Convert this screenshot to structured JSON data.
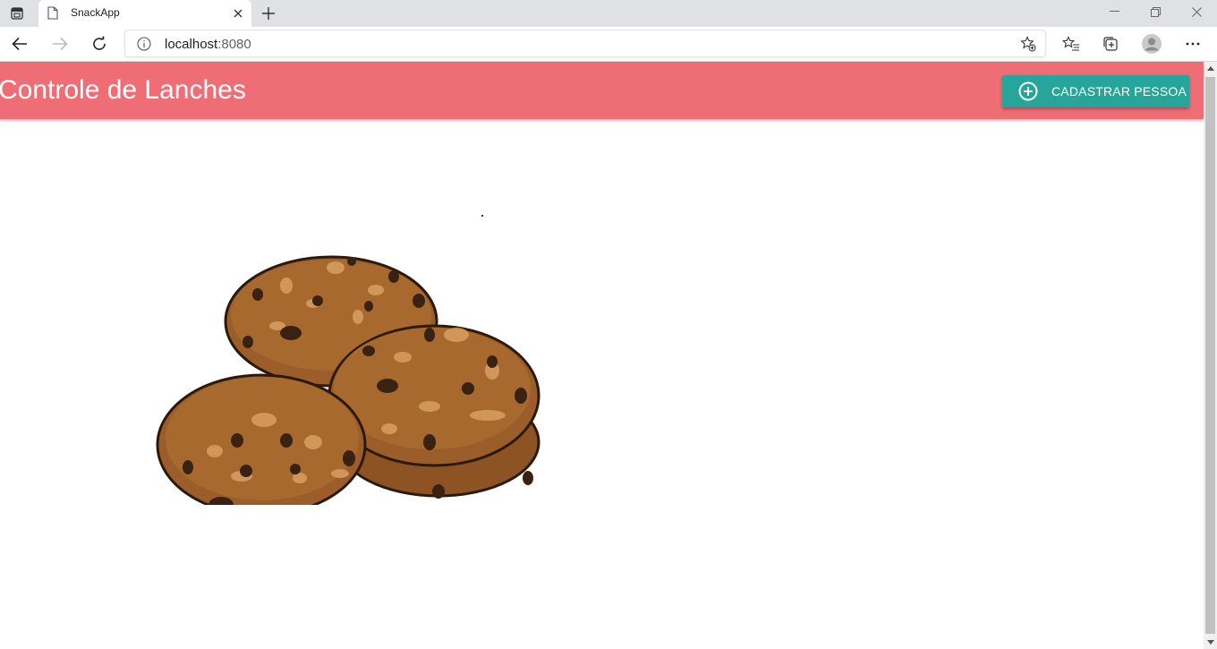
{
  "browser": {
    "tab": {
      "title": "SnackApp",
      "icon": "page-icon"
    },
    "url": {
      "host": "localhost",
      "port": ":8080"
    },
    "icons": [
      "tab-actions-icon",
      "close-icon",
      "plus-icon",
      "minimize-icon",
      "restore-icon",
      "close-window-icon",
      "back-arrow-icon",
      "forward-arrow-icon",
      "reload-icon",
      "info-icon",
      "add-favorite-icon",
      "favorites-icon",
      "collections-icon",
      "profile-avatar-icon",
      "more-icon"
    ]
  },
  "app": {
    "title": "Controle de Lanches",
    "header_color": "#ef6d74",
    "register_button": {
      "label": "CADASTRAR PESSOA",
      "icon": "add-circle-icon",
      "color": "#26a69a"
    },
    "hero_image": "cookies-illustration"
  }
}
